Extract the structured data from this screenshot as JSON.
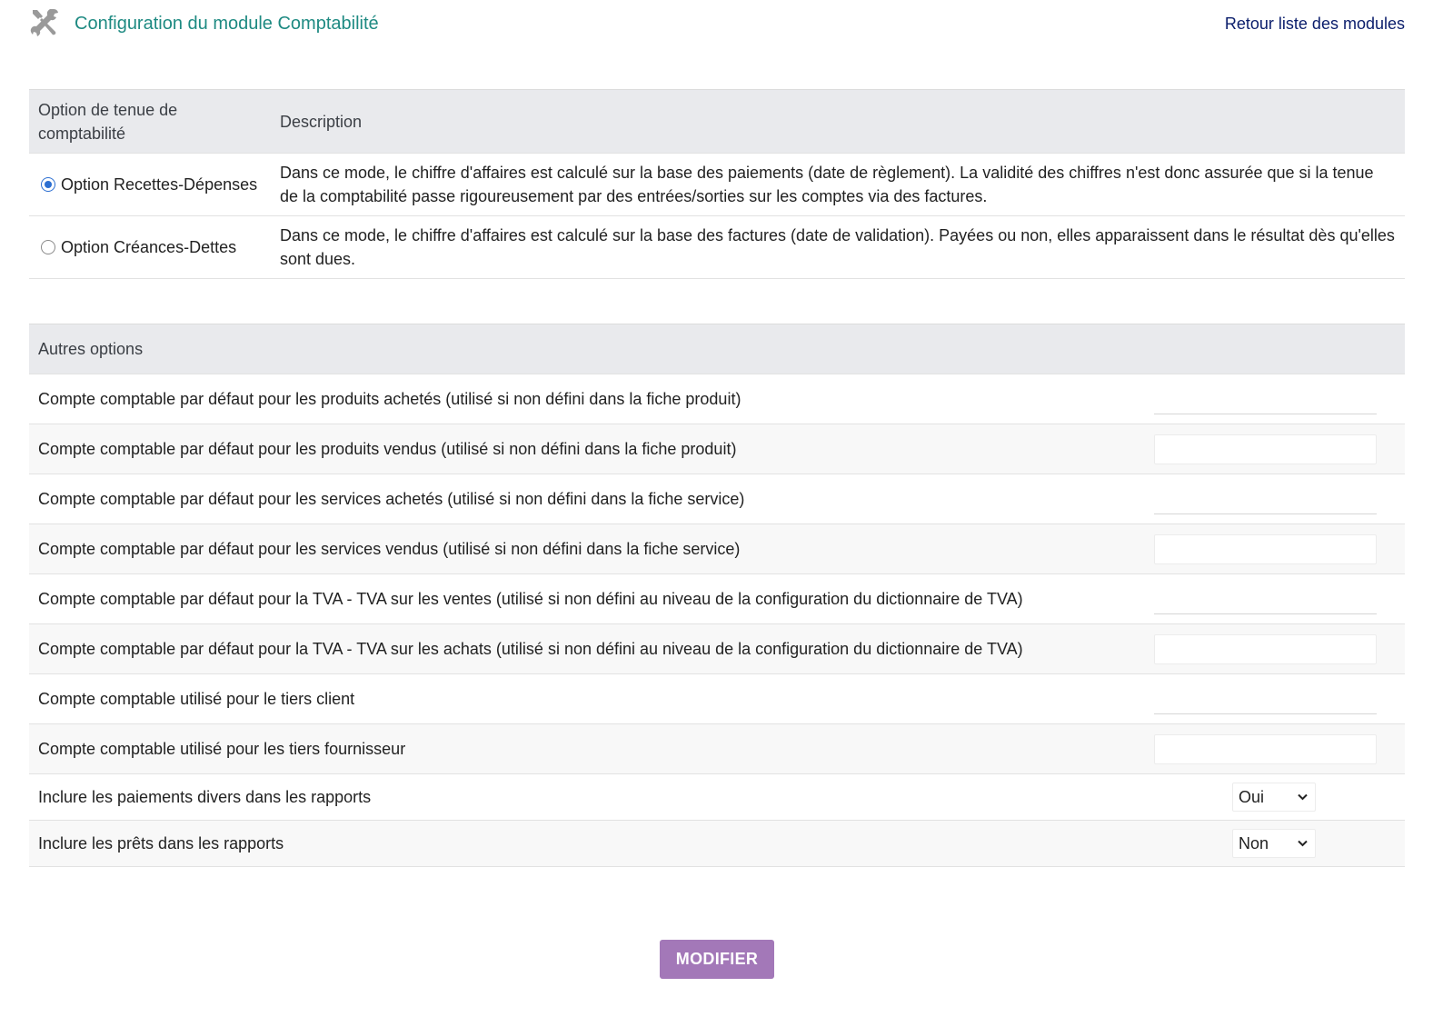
{
  "header": {
    "title": "Configuration du module Comptabilité",
    "back_link": "Retour liste des modules",
    "icon": "tools-icon"
  },
  "mode_table": {
    "col_option": "Option de tenue de comptabilité",
    "col_description": "Description",
    "options": [
      {
        "label": "Option Recettes-Dépenses",
        "selected": true,
        "description": "Dans ce mode, le chiffre d'affaires est calculé sur la base des paiements (date de règlement). La validité des chiffres n'est donc assurée que si la tenue de la comptabilité passe rigoureusement par des entrées/sorties sur les comptes via des factures."
      },
      {
        "label": "Option Créances-Dettes",
        "selected": false,
        "description": "Dans ce mode, le chiffre d'affaires est calculé sur la base des factures (date de validation). Payées ou non, elles apparaissent dans le résultat dès qu'elles sont dues."
      }
    ]
  },
  "other_options": {
    "header": "Autres options",
    "accounts": [
      {
        "label": "Compte comptable par défaut pour les produits achetés (utilisé si non défini dans la fiche produit)",
        "value": ""
      },
      {
        "label": "Compte comptable par défaut pour les produits vendus (utilisé si non défini dans la fiche produit)",
        "value": ""
      },
      {
        "label": "Compte comptable par défaut pour les services achetés (utilisé si non défini dans la fiche service)",
        "value": ""
      },
      {
        "label": "Compte comptable par défaut pour les services vendus (utilisé si non défini dans la fiche service)",
        "value": ""
      },
      {
        "label": "Compte comptable par défaut pour la TVA - TVA sur les ventes (utilisé si non défini au niveau de la configuration du dictionnaire de TVA)",
        "value": ""
      },
      {
        "label": "Compte comptable par défaut pour la TVA - TVA sur les achats (utilisé si non défini au niveau de la configuration du dictionnaire de TVA)",
        "value": ""
      },
      {
        "label": "Compte comptable utilisé pour le tiers client",
        "value": ""
      },
      {
        "label": "Compte comptable utilisé pour les tiers fournisseur",
        "value": ""
      }
    ],
    "selects": [
      {
        "label": "Inclure les paiements divers dans les rapports",
        "value": "Oui"
      },
      {
        "label": "Inclure les prêts dans les rapports",
        "value": "Non"
      }
    ]
  },
  "submit_label": "MODIFIER",
  "colors": {
    "title": "#1e8a82",
    "link": "#0a1d6b",
    "button": "#a378b8",
    "header_bg": "#e9eaed",
    "radio_checked": "#2c6fd1"
  }
}
